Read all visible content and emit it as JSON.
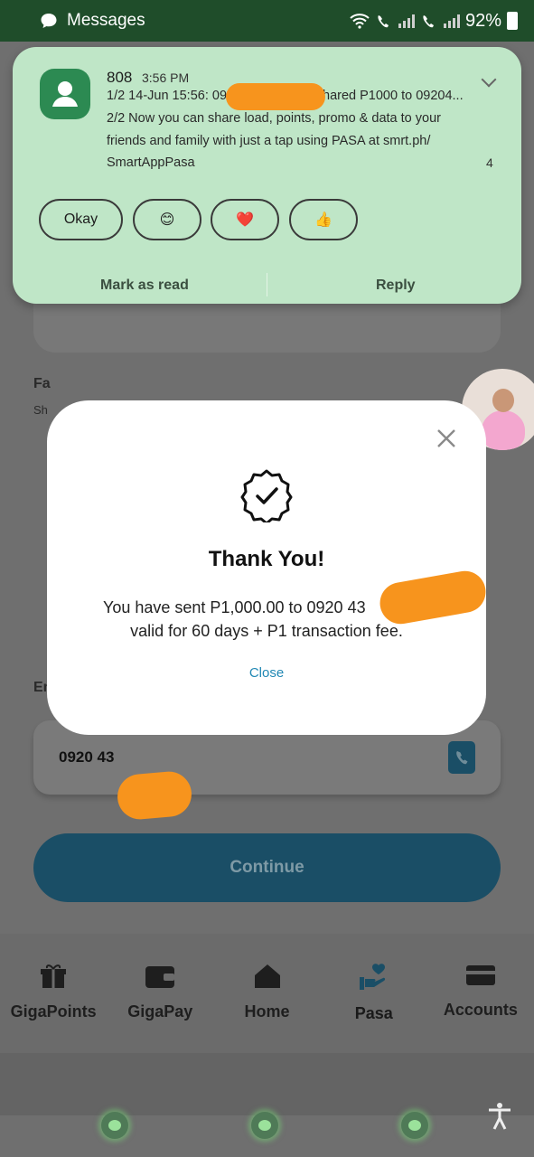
{
  "status_bar": {
    "app_label": "Messages",
    "battery": "92%"
  },
  "notification": {
    "sender": "808",
    "time": "3:56 PM",
    "line1a": "1/2 14-Jun 15:56: 09",
    "line1b": "hared P1000 to 09204...",
    "line2": "2/2 Now you can share load, points, promo & data to your",
    "line3": "friends and family with just a tap using PASA at smrt.ph/",
    "line4": "SmartAppPasa",
    "count": "4",
    "quick_replies": [
      "Okay",
      "😊",
      "❤️",
      "👍"
    ],
    "mark_read": "Mark as read",
    "reply": "Reply"
  },
  "background": {
    "fav_label": "Fa",
    "fav_sub": "Sh",
    "enter_label": "Enter",
    "number": "0920 43",
    "continue_label": "Continue"
  },
  "modal": {
    "title": "Thank You!",
    "message_line1": "You have sent P1,000.00 to 0920 43",
    "message_line2": "valid for 60 days + P1 transaction fee.",
    "close_label": "Close"
  },
  "bottom_nav": [
    {
      "label": "GigaPoints",
      "icon": "gift-icon"
    },
    {
      "label": "GigaPay",
      "icon": "wallet-icon"
    },
    {
      "label": "Home",
      "icon": "home-icon"
    },
    {
      "label": "Pasa",
      "icon": "pasa-heart-hand-icon",
      "active": true
    },
    {
      "label": "Accounts",
      "icon": "card-icon"
    }
  ],
  "colors": {
    "brand_blue": "#1a4e66",
    "notif_bg": "#bfe6c7",
    "link": "#2188b4",
    "redaction": "#f7941d"
  }
}
